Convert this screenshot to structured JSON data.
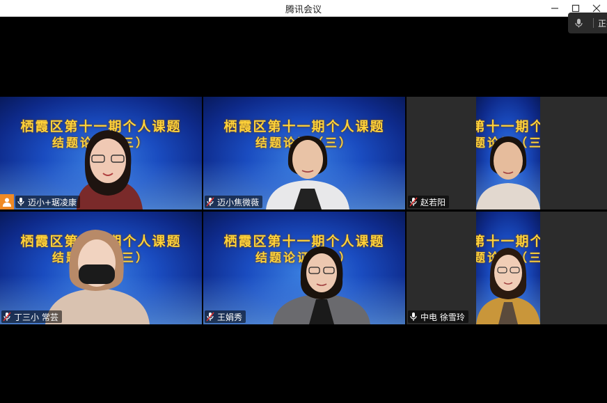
{
  "window": {
    "title": "腾讯会议"
  },
  "speaking": {
    "label": "正在"
  },
  "banner": {
    "line1": "栖霞区第十一期个人课题",
    "line2": "结题论证（三）"
  },
  "participants": [
    {
      "name": "迈小+琚凌康",
      "mic": "on"
    },
    {
      "name": "迈小焦微薇",
      "mic": "muted"
    },
    {
      "name": "赵若阳",
      "mic": "muted"
    },
    {
      "name": "丁三小 常芸",
      "mic": "muted"
    },
    {
      "name": "王娟秀",
      "mic": "muted"
    },
    {
      "name": "中电 徐雪玲",
      "mic": "on"
    }
  ],
  "colors": {
    "accent": "#f08a24",
    "banner_text": "#ffd23a"
  }
}
